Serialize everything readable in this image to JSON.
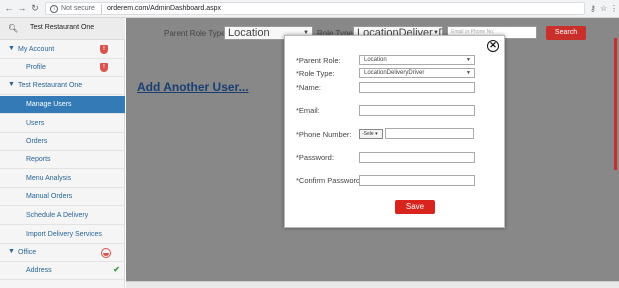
{
  "browser": {
    "back_icon": "arrow-left",
    "forward_icon": "arrow-right",
    "reload_icon": "reload",
    "security_label": "Not secure",
    "url": "orderem.com/AdminDashboard.aspx",
    "star_icon": "star",
    "menu_icon": "kebab-menu"
  },
  "sidebar": {
    "restaurant": "Test Restaurant One",
    "sections": [
      {
        "label": "My Account"
      },
      {
        "label": "Test Restaurant One"
      },
      {
        "label": "Office"
      }
    ],
    "items": [
      {
        "label": "Profile"
      },
      {
        "label": "Manage Users"
      },
      {
        "label": "Users"
      },
      {
        "label": "Orders"
      },
      {
        "label": "Reports"
      },
      {
        "label": "Menu Analysis"
      },
      {
        "label": "Manual Orders"
      },
      {
        "label": "Schedule A Delivery"
      },
      {
        "label": "Import Delivery Services"
      },
      {
        "label": "Address"
      }
    ],
    "shield_text": "!",
    "check": "✔",
    "active_color": "#337ab7"
  },
  "filters": {
    "parent_role_label": "Parent Role Type:",
    "parent_role_value": "Location",
    "role_type_label": "Role Type:",
    "role_type_value": "LocationDeliveryD",
    "search_placeholder": "Email or Phone No.",
    "search_button": "Search"
  },
  "main": {
    "add_user_link": "Add Another User..."
  },
  "modal": {
    "close_symbol": "✕",
    "parent_role_label": "*Parent Role:",
    "parent_role_value": "Location",
    "role_type_label": "*Role Type:",
    "role_type_value": "LocationDeliveryDriver",
    "name_label": "*Name:",
    "email_label": "*Email:",
    "phone_label": "*Phone Number:",
    "phone_code_value": "-Sele",
    "password_label": "*Password:",
    "confirm_password_label": "*Confirm Password:",
    "save_button": "Save",
    "accent_color": "#d9241d"
  }
}
